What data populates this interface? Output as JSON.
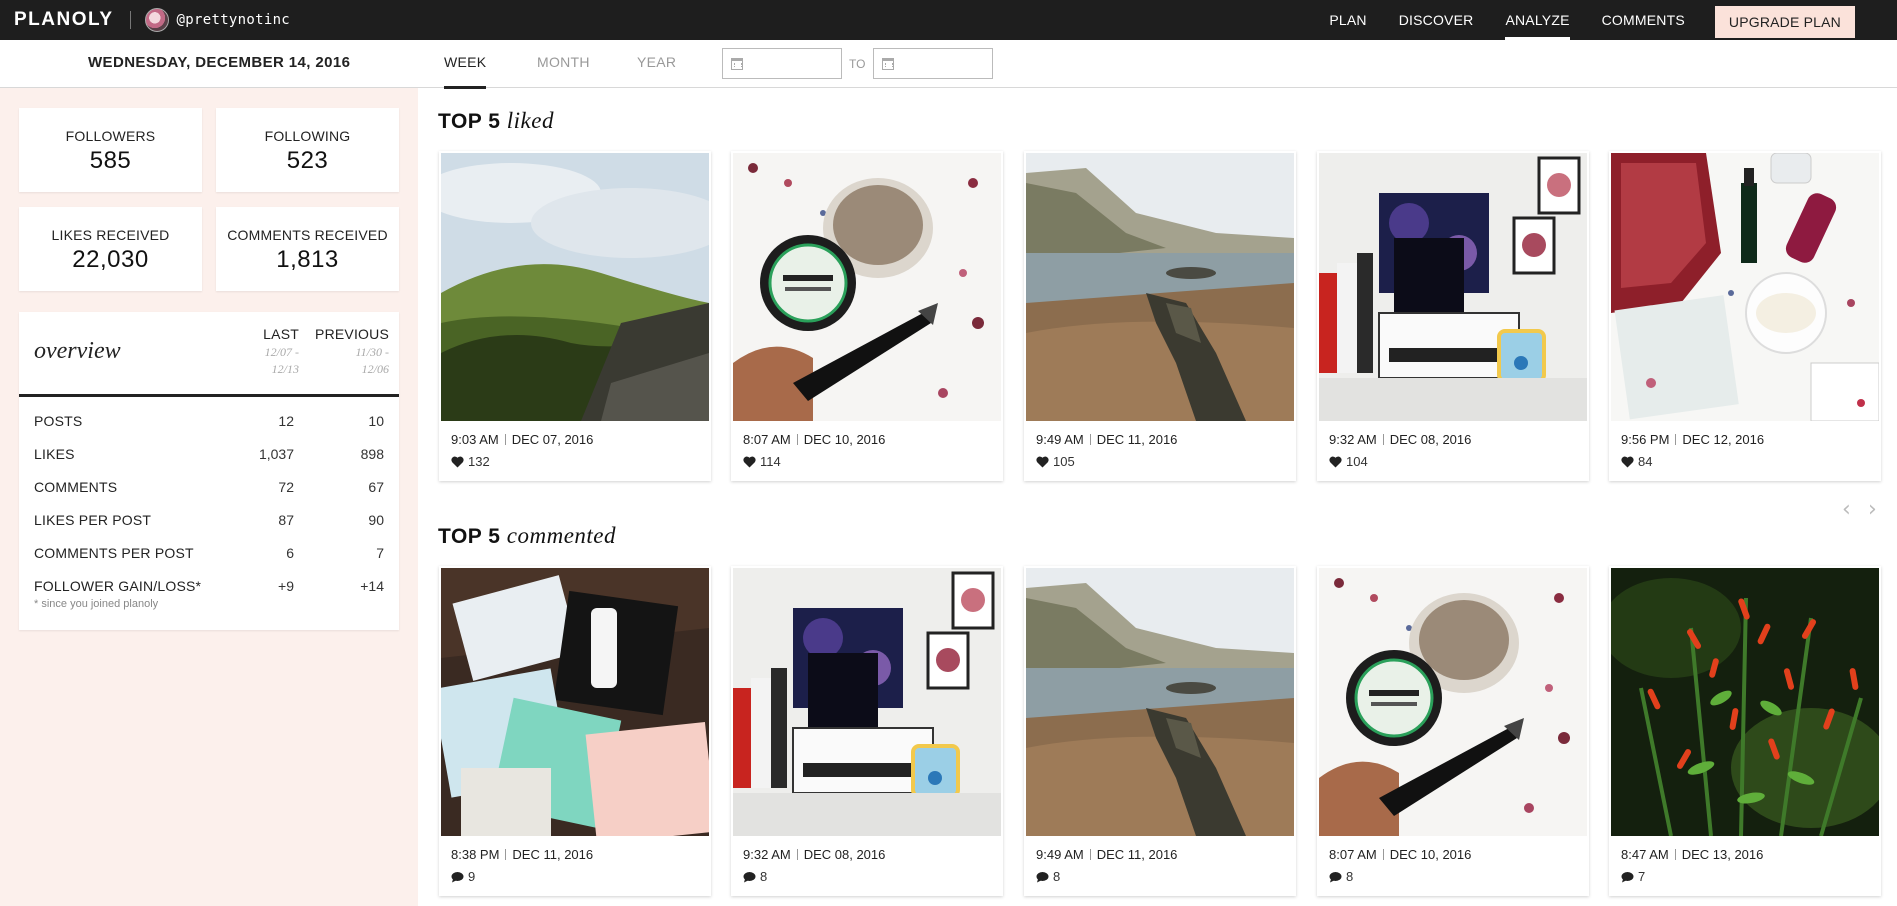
{
  "app": {
    "brand": "PLANOLY",
    "handle": "@prettynotinc"
  },
  "nav": {
    "items": [
      "PLAN",
      "DISCOVER",
      "ANALYZE",
      "COMMENTS"
    ],
    "active": "ANALYZE",
    "upgrade_label": "UPGRADE PLAN"
  },
  "subheader": {
    "date": "WEDNESDAY, DECEMBER 14, 2016",
    "tabs": [
      "WEEK",
      "MONTH",
      "YEAR"
    ],
    "active_tab": "WEEK",
    "to_label": "TO"
  },
  "stats": {
    "followers": {
      "label": "FOLLOWERS",
      "value": "585"
    },
    "following": {
      "label": "FOLLOWING",
      "value": "523"
    },
    "likes_received": {
      "label": "LIKES RECEIVED",
      "value": "22,030"
    },
    "comments_received": {
      "label": "COMMENTS RECEIVED",
      "value": "1,813"
    }
  },
  "overview": {
    "title": "overview",
    "last": {
      "label": "LAST",
      "range_start": "12/07 -",
      "range_end": "12/13"
    },
    "previous": {
      "label": "PREVIOUS",
      "range_start": "11/30 -",
      "range_end": "12/06"
    },
    "rows": [
      {
        "label": "POSTS",
        "last": "12",
        "previous": "10"
      },
      {
        "label": "LIKES",
        "last": "1,037",
        "previous": "898"
      },
      {
        "label": "COMMENTS",
        "last": "72",
        "previous": "67"
      },
      {
        "label": "LIKES PER POST",
        "last": "87",
        "previous": "90"
      },
      {
        "label": "COMMENTS PER POST",
        "last": "6",
        "previous": "7"
      },
      {
        "label": "FOLLOWER GAIN/LOSS*",
        "last": "+9",
        "previous": "+14"
      }
    ],
    "note": "* since you joined planoly"
  },
  "top_liked": {
    "title_prefix": "TOP 5",
    "title_suffix": "liked",
    "posts": [
      {
        "time": "9:03 AM",
        "date": "DEC 07, 2016",
        "count": "132"
      },
      {
        "time": "8:07 AM",
        "date": "DEC 10, 2016",
        "count": "114"
      },
      {
        "time": "9:49 AM",
        "date": "DEC 11, 2016",
        "count": "105"
      },
      {
        "time": "9:32 AM",
        "date": "DEC 08, 2016",
        "count": "104"
      },
      {
        "time": "9:56 PM",
        "date": "DEC 12, 2016",
        "count": "84"
      }
    ]
  },
  "top_commented": {
    "title_prefix": "TOP 5",
    "title_suffix": "commented",
    "posts": [
      {
        "time": "8:38 PM",
        "date": "DEC 11, 2016",
        "count": "9"
      },
      {
        "time": "9:32 AM",
        "date": "DEC 08, 2016",
        "count": "8"
      },
      {
        "time": "9:49 AM",
        "date": "DEC 11, 2016",
        "count": "8"
      },
      {
        "time": "8:07 AM",
        "date": "DEC 10, 2016",
        "count": "8"
      },
      {
        "time": "8:47 AM",
        "date": "DEC 13, 2016",
        "count": "7"
      }
    ]
  },
  "icons": {
    "calendar": "calendar-icon",
    "heart": "heart-icon",
    "comment": "comment-icon",
    "prev": "chevron-left-icon",
    "next": "chevron-right-icon"
  }
}
